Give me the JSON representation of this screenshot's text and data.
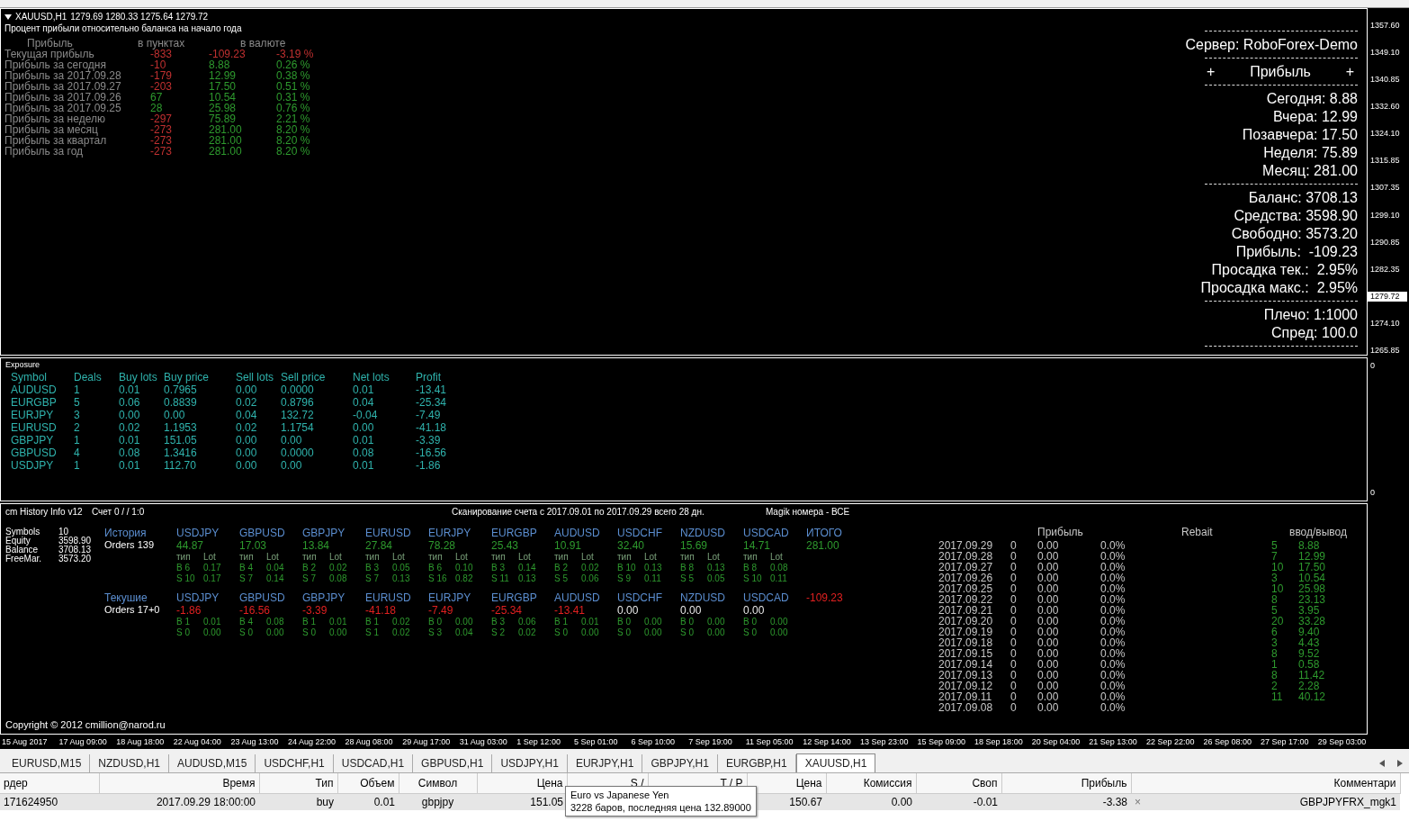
{
  "chart": {
    "title": "XAUUSD,H1",
    "ohlc": "1279.69 1280.33 1275.64 1279.72",
    "subtitle": "Процент прибыли относительно баланса на начало года",
    "profit_table": {
      "columns": [
        "Прибыль",
        "в пунктах",
        "в валюте"
      ],
      "rows": [
        {
          "label": "Текущая прибыль",
          "points": {
            "text": "-833",
            "color": "#c03030"
          },
          "money": {
            "text": "-109.23",
            "color": "#c03030"
          },
          "percent": {
            "text": "-3.19 %",
            "color": "#c03030"
          }
        },
        {
          "label": "Прибыль за сегодня",
          "points": {
            "text": "-10",
            "color": "#c03030"
          },
          "money": {
            "text": "8.88",
            "color": "#2e9a2e"
          },
          "percent": {
            "text": "0.26 %",
            "color": "#2e9a2e"
          }
        },
        {
          "label": "Прибыль за 2017.09.28",
          "points": {
            "text": "-179",
            "color": "#c03030"
          },
          "money": {
            "text": "12.99",
            "color": "#2e9a2e"
          },
          "percent": {
            "text": "0.38 %",
            "color": "#2e9a2e"
          }
        },
        {
          "label": "Прибыль за 2017.09.27",
          "points": {
            "text": "-203",
            "color": "#c03030"
          },
          "money": {
            "text": "17.50",
            "color": "#2e9a2e"
          },
          "percent": {
            "text": "0.51 %",
            "color": "#2e9a2e"
          }
        },
        {
          "label": "Прибыль за 2017.09.26",
          "points": {
            "text": "67",
            "color": "#2e9a2e"
          },
          "money": {
            "text": "10.54",
            "color": "#2e9a2e"
          },
          "percent": {
            "text": "0.31 %",
            "color": "#2e9a2e"
          }
        },
        {
          "label": "Прибыль за 2017.09.25",
          "points": {
            "text": "28",
            "color": "#2e9a2e"
          },
          "money": {
            "text": "25.98",
            "color": "#2e9a2e"
          },
          "percent": {
            "text": "0.76 %",
            "color": "#2e9a2e"
          }
        },
        {
          "label": "Прибыль за неделю",
          "points": {
            "text": "-297",
            "color": "#c03030"
          },
          "money": {
            "text": "75.89",
            "color": "#2e9a2e"
          },
          "percent": {
            "text": "2.21 %",
            "color": "#2e9a2e"
          }
        },
        {
          "label": "Прибыль за месяц",
          "points": {
            "text": "-273",
            "color": "#c03030"
          },
          "money": {
            "text": "281.00",
            "color": "#2e9a2e"
          },
          "percent": {
            "text": "8.20 %",
            "color": "#2e9a2e"
          }
        },
        {
          "label": "Прибыль за квартал",
          "points": {
            "text": "-273",
            "color": "#c03030"
          },
          "money": {
            "text": "281.00",
            "color": "#2e9a2e"
          },
          "percent": {
            "text": "8.20 %",
            "color": "#2e9a2e"
          }
        },
        {
          "label": "Прибыль за год",
          "points": {
            "text": "-273",
            "color": "#c03030"
          },
          "money": {
            "text": "281.00",
            "color": "#2e9a2e"
          },
          "percent": {
            "text": "8.20 %",
            "color": "#2e9a2e"
          }
        }
      ]
    },
    "account_panel": {
      "server": "Сервер: RoboForex-Demo",
      "header": [
        "+",
        "Прибыль",
        "+"
      ],
      "groups": [
        [
          "Сегодня: 8.88",
          "Вчера: 12.99",
          "Позавчера: 17.50",
          "Неделя: 75.89",
          "Месяц: 281.00"
        ],
        [
          "Баланс: 3708.13",
          "Средства: 3598.90",
          "Свободно: 3573.20",
          "Прибыль:  -109.23",
          "Просадка тек.:  2.95%",
          "Просадка макс.:  2.95%"
        ],
        [
          "Плечо: 1:1000",
          "Спред: 100.0"
        ]
      ]
    },
    "price_axis": [
      {
        "text": "1357.60",
        "current": false
      },
      {
        "text": "1349.10",
        "current": false
      },
      {
        "text": "1340.85",
        "current": false
      },
      {
        "text": "1332.60",
        "current": false
      },
      {
        "text": "1324.10",
        "current": false
      },
      {
        "text": "1315.85",
        "current": false
      },
      {
        "text": "1307.35",
        "current": false
      },
      {
        "text": "1299.10",
        "current": false
      },
      {
        "text": "1290.85",
        "current": false
      },
      {
        "text": "1282.35",
        "current": false
      },
      {
        "text": "1279.72",
        "current": true
      },
      {
        "text": "1274.10",
        "current": false
      },
      {
        "text": "1265.85",
        "current": false
      }
    ],
    "exposure": {
      "title": "Exposure",
      "axis": [
        "0",
        "0"
      ],
      "columns": [
        "Symbol",
        "Deals",
        "Buy lots",
        "Buy price",
        "Sell lots",
        "Sell price",
        "Net lots",
        "Profit"
      ],
      "rows": [
        [
          "AUDUSD",
          "1",
          "0.01",
          "0.7965",
          "0.00",
          "0.0000",
          "0.01",
          "-13.41"
        ],
        [
          "EURGBP",
          "5",
          "0.06",
          "0.8839",
          "0.02",
          "0.8796",
          "0.04",
          "-25.34"
        ],
        [
          "EURJPY",
          "3",
          "0.00",
          "0.00",
          "0.04",
          "132.72",
          "-0.04",
          "-7.49"
        ],
        [
          "EURUSD",
          "2",
          "0.02",
          "1.1953",
          "0.02",
          "1.1754",
          "0.00",
          "-41.18"
        ],
        [
          "GBPJPY",
          "1",
          "0.01",
          "151.05",
          "0.00",
          "0.00",
          "0.01",
          "-3.39"
        ],
        [
          "GBPUSD",
          "4",
          "0.08",
          "1.3416",
          "0.00",
          "0.0000",
          "0.08",
          "-16.56"
        ],
        [
          "USDJPY",
          "1",
          "0.01",
          "112.70",
          "0.00",
          "0.00",
          "0.01",
          "-1.86"
        ]
      ]
    },
    "history": {
      "title": "cm History Info v12",
      "account": "Счет 0 / / 1:0",
      "scan": "Сканирование счета с 2017.09.01 по 2017.09.29 всего 28 дн.",
      "magic": "Magik номера - ВСЕ",
      "stats": [
        [
          "Symbols",
          "10"
        ],
        [
          "Equity",
          "3598.90"
        ],
        [
          "Balance",
          "3708.13"
        ],
        [
          "FreeMar.",
          "3573.20"
        ]
      ],
      "sections": [
        {
          "title": "История",
          "orders": "Orders 139",
          "total": {
            "label": "ИТОГО",
            "value": "281.00",
            "color": "#2e9a2e"
          },
          "symbols": [
            {
              "name": "USDJPY",
              "value": "44.87",
              "color": "#2e9a2e",
              "header": [
                "тип",
                "Lot"
              ],
              "buy": [
                "B 6",
                "0.17"
              ],
              "sell": [
                "S 10",
                "0.17"
              ]
            },
            {
              "name": "GBPUSD",
              "value": "17.03",
              "color": "#2e9a2e",
              "header": [
                "тип",
                "Lot"
              ],
              "buy": [
                "B 4",
                "0.04"
              ],
              "sell": [
                "S 7",
                "0.14"
              ]
            },
            {
              "name": "GBPJPY",
              "value": "13.84",
              "color": "#2e9a2e",
              "header": [
                "тип",
                "Lot"
              ],
              "buy": [
                "B 2",
                "0.02"
              ],
              "sell": [
                "S 7",
                "0.08"
              ]
            },
            {
              "name": "EURUSD",
              "value": "27.84",
              "color": "#2e9a2e",
              "header": [
                "тип",
                "Lot"
              ],
              "buy": [
                "B 3",
                "0.05"
              ],
              "sell": [
                "S 7",
                "0.13"
              ]
            },
            {
              "name": "EURJPY",
              "value": "78.28",
              "color": "#2e9a2e",
              "header": [
                "тип",
                "Lot"
              ],
              "buy": [
                "B 6",
                "0.10"
              ],
              "sell": [
                "S 16",
                "0.82"
              ]
            },
            {
              "name": "EURGBP",
              "value": "25.43",
              "color": "#2e9a2e",
              "header": [
                "тип",
                "Lot"
              ],
              "buy": [
                "B 3",
                "0.14"
              ],
              "sell": [
                "S 11",
                "0.13"
              ]
            },
            {
              "name": "AUDUSD",
              "value": "10.91",
              "color": "#2e9a2e",
              "header": [
                "тип",
                "Lot"
              ],
              "buy": [
                "B 2",
                "0.02"
              ],
              "sell": [
                "S 5",
                "0.06"
              ]
            },
            {
              "name": "USDCHF",
              "value": "32.40",
              "color": "#2e9a2e",
              "header": [
                "тип",
                "Lot"
              ],
              "buy": [
                "B 10",
                "0.13"
              ],
              "sell": [
                "S 9",
                "0.11"
              ]
            },
            {
              "name": "NZDUSD",
              "value": "15.69",
              "color": "#2e9a2e",
              "header": [
                "тип",
                "Lot"
              ],
              "buy": [
                "B 8",
                "0.13"
              ],
              "sell": [
                "S 5",
                "0.05"
              ]
            },
            {
              "name": "USDCAD",
              "value": "14.71",
              "color": "#2e9a2e",
              "header": [
                "тип",
                "Lot"
              ],
              "buy": [
                "B 8",
                "0.08"
              ],
              "sell": [
                "S 10",
                "0.11"
              ]
            }
          ]
        },
        {
          "title": "Текушие",
          "orders": "Orders 17+0",
          "total": {
            "value": "-109.23",
            "color": "#e02020"
          },
          "symbols": [
            {
              "name": "USDJPY",
              "value": "-1.86",
              "color": "#e02020",
              "buy": [
                "B 1",
                "0.01"
              ],
              "sell": [
                "S 0",
                "0.00"
              ]
            },
            {
              "name": "GBPUSD",
              "value": "-16.56",
              "color": "#e02020",
              "buy": [
                "B 4",
                "0.08"
              ],
              "sell": [
                "S 0",
                "0.00"
              ]
            },
            {
              "name": "GBPJPY",
              "value": "-3.39",
              "color": "#e02020",
              "buy": [
                "B 1",
                "0.01"
              ],
              "sell": [
                "S 0",
                "0.00"
              ]
            },
            {
              "name": "EURUSD",
              "value": "-41.18",
              "color": "#e02020",
              "buy": [
                "B 1",
                "0.02"
              ],
              "sell": [
                "S 1",
                "0.02"
              ]
            },
            {
              "name": "EURJPY",
              "value": "-7.49",
              "color": "#e02020",
              "buy": [
                "B 0",
                "0.00"
              ],
              "sell": [
                "S 3",
                "0.04"
              ]
            },
            {
              "name": "EURGBP",
              "value": "-25.34",
              "color": "#e02020",
              "buy": [
                "B 3",
                "0.06"
              ],
              "sell": [
                "S 2",
                "0.02"
              ]
            },
            {
              "name": "AUDUSD",
              "value": "-13.41",
              "color": "#e02020",
              "buy": [
                "B 1",
                "0.01"
              ],
              "sell": [
                "S 0",
                "0.00"
              ]
            },
            {
              "name": "USDCHF",
              "value": "0.00",
              "color": "#e8e8e8",
              "buy": [
                "B 0",
                "0.00"
              ],
              "sell": [
                "S 0",
                "0.00"
              ]
            },
            {
              "name": "NZDUSD",
              "value": "0.00",
              "color": "#e8e8e8",
              "buy": [
                "B 0",
                "0.00"
              ],
              "sell": [
                "S 0",
                "0.00"
              ]
            },
            {
              "name": "USDCAD",
              "value": "0.00",
              "color": "#e8e8e8",
              "buy": [
                "B 0",
                "0.00"
              ],
              "sell": [
                "S 0",
                "0.00"
              ]
            }
          ]
        }
      ],
      "daily_header": [
        "Прибыль",
        "Rebait",
        "ввод/вывод"
      ],
      "daily": [
        {
          "date": "2017.09.29",
          "trades": "0",
          "profit": "0.00",
          "percent": "0.0%",
          "count": "5",
          "amount": "8.88"
        },
        {
          "date": "2017.09.28",
          "trades": "0",
          "profit": "0.00",
          "percent": "0.0%",
          "count": "7",
          "amount": "12.99"
        },
        {
          "date": "2017.09.27",
          "trades": "0",
          "profit": "0.00",
          "percent": "0.0%",
          "count": "10",
          "amount": "17.50"
        },
        {
          "date": "2017.09.26",
          "trades": "0",
          "profit": "0.00",
          "percent": "0.0%",
          "count": "3",
          "amount": "10.54"
        },
        {
          "date": "2017.09.25",
          "trades": "0",
          "profit": "0.00",
          "percent": "0.0%",
          "count": "10",
          "amount": "25.98"
        },
        {
          "date": "2017.09.22",
          "trades": "0",
          "profit": "0.00",
          "percent": "0.0%",
          "count": "8",
          "amount": "23.13"
        },
        {
          "date": "2017.09.21",
          "trades": "0",
          "profit": "0.00",
          "percent": "0.0%",
          "count": "5",
          "amount": "3.95"
        },
        {
          "date": "2017.09.20",
          "trades": "0",
          "profit": "0.00",
          "percent": "0.0%",
          "count": "20",
          "amount": "33.28"
        },
        {
          "date": "2017.09.19",
          "trades": "0",
          "profit": "0.00",
          "percent": "0.0%",
          "count": "6",
          "amount": "9.40"
        },
        {
          "date": "2017.09.18",
          "trades": "0",
          "profit": "0.00",
          "percent": "0.0%",
          "count": "3",
          "amount": "4.43"
        },
        {
          "date": "2017.09.15",
          "trades": "0",
          "profit": "0.00",
          "percent": "0.0%",
          "count": "8",
          "amount": "9.52"
        },
        {
          "date": "2017.09.14",
          "trades": "0",
          "profit": "0.00",
          "percent": "0.0%",
          "count": "1",
          "amount": "0.58"
        },
        {
          "date": "2017.09.13",
          "trades": "0",
          "profit": "0.00",
          "percent": "0.0%",
          "count": "8",
          "amount": "11.42"
        },
        {
          "date": "2017.09.12",
          "trades": "0",
          "profit": "0.00",
          "percent": "0.0%",
          "count": "2",
          "amount": "2.28"
        },
        {
          "date": "2017.09.11",
          "trades": "0",
          "profit": "0.00",
          "percent": "0.0%",
          "count": "11",
          "amount": "40.12"
        },
        {
          "date": "2017.09.08",
          "trades": "0",
          "profit": "0.00",
          "percent": "0.0%"
        }
      ],
      "copyright": "Copyright © 2012 cmillion@narod.ru"
    },
    "time_axis": [
      "15 Aug 2017",
      "17 Aug 09:00",
      "18 Aug 18:00",
      "22 Aug 04:00",
      "23 Aug 13:00",
      "24 Aug 22:00",
      "28 Aug 08:00",
      "29 Aug 17:00",
      "31 Aug 03:00",
      "1 Sep 12:00",
      "5 Sep 01:00",
      "6 Sep 10:00",
      "7 Sep 19:00",
      "11 Sep 05:00",
      "12 Sep 14:00",
      "13 Sep 23:00",
      "15 Sep 09:00",
      "18 Sep 18:00",
      "20 Sep 04:00",
      "21 Sep 13:00",
      "22 Sep 22:00",
      "26 Sep 08:00",
      "27 Sep 17:00",
      "29 Sep 03:00"
    ]
  },
  "tabs": [
    {
      "label": "EURUSD,M15",
      "selected": false
    },
    {
      "label": "NZDUSD,H1",
      "selected": false
    },
    {
      "label": "AUDUSD,M15",
      "selected": false
    },
    {
      "label": "USDCHF,H1",
      "selected": false
    },
    {
      "label": "USDCAD,H1",
      "selected": false
    },
    {
      "label": "GBPUSD,H1",
      "selected": false
    },
    {
      "label": "USDJPY,H1",
      "selected": false
    },
    {
      "label": "EURJPY,H1",
      "selected": false
    },
    {
      "label": "GBPJPY,H1",
      "selected": false
    },
    {
      "label": "EURGBP,H1",
      "selected": false
    },
    {
      "label": "XAUUSD,H1",
      "selected": true
    }
  ],
  "terminal": {
    "columns": [
      "рдер",
      "Время",
      "Тип",
      "Объем",
      "Символ",
      "Цена",
      "S /",
      "T / P",
      "Цена",
      "Комиссия",
      "Своп",
      "Прибыль",
      "Комментари"
    ],
    "rows": [
      {
        "selected": true,
        "close": "×",
        "cells": [
          "171624950",
          "2017.09.29 18:00:00",
          "buy",
          "0.01",
          "gbpjpy",
          "151.05",
          "",
          "",
          "150.67",
          "0.00",
          "-0.01",
          "-3.38",
          "GBPJPYFRX_mgk1"
        ]
      }
    ]
  },
  "tooltip": {
    "title": "Euro vs Japanese Yen",
    "text": "3228 баров, последняя цена 132.89000"
  }
}
